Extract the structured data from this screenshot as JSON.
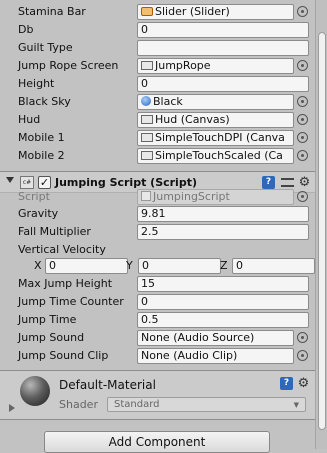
{
  "fields_top": [
    {
      "label": "Stamina Bar",
      "value": "Slider (Slider)",
      "icon": "slider-icon"
    },
    {
      "label": "Db",
      "value": "0"
    },
    {
      "label": "Guilt Type",
      "value": ""
    },
    {
      "label": "Jump Rope Screen",
      "value": "JumpRope",
      "icon": "rect-transform-icon"
    },
    {
      "label": "Height",
      "value": "0"
    },
    {
      "label": "Black Sky",
      "value": "Black",
      "icon": "skybox-icon"
    },
    {
      "label": "Hud",
      "value": "Hud (Canvas)",
      "icon": "rect-transform-icon"
    },
    {
      "label": "Mobile 1",
      "value": "SimpleTouchDPI (Canva",
      "icon": "rect-transform-icon"
    },
    {
      "label": "Mobile 2",
      "value": "SimpleTouchScaled (Ca",
      "icon": "rect-transform-icon"
    }
  ],
  "component": {
    "title": "Jumping Script (Script)",
    "enabled_mark": "✓",
    "icon_text": "c#",
    "help_text": "?",
    "gear_glyph": "⚙",
    "script_label": "Script",
    "script_value": "JumpingScript",
    "gravity_label": "Gravity",
    "gravity_value": "9.81",
    "fall_label": "Fall Multiplier",
    "fall_value": "2.5",
    "vertical_label": "Vertical Velocity",
    "vx_label": "X",
    "vx_value": "0",
    "vy_label": "Y",
    "vy_value": "0",
    "vz_label": "Z",
    "vz_value": "0",
    "max_jump_label": "Max Jump Height",
    "max_jump_value": "15",
    "counter_label": "Jump Time Counter",
    "counter_value": "0",
    "jump_time_label": "Jump Time",
    "jump_time_value": "0.5",
    "sound_label": "Jump Sound",
    "sound_value": "None (Audio Source)",
    "clip_label": "Jump Sound Clip",
    "clip_value": "None (Audio Clip)"
  },
  "material": {
    "name": "Default-Material",
    "help_text": "?",
    "gear_glyph": "⚙",
    "shader_label": "Shader",
    "shader_value": "Standard",
    "dropdown_arrow": "▼"
  },
  "add_component_label": "Add Component",
  "colors": {
    "panel_bg": "#c2c2c2",
    "help_blue": "#2f68b9",
    "slider_icon": "#f0c070"
  }
}
